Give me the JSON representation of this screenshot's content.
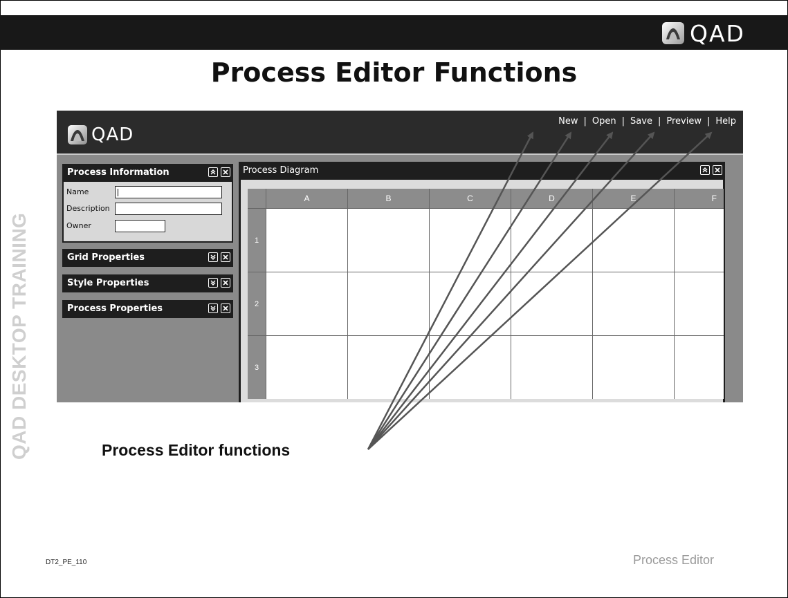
{
  "header": {
    "logo_text": "QAD",
    "slide_title": "Process Editor Functions",
    "side_text": "QAD DESKTOP TRAINING"
  },
  "app": {
    "logo_text": "QAD",
    "menu": [
      "New",
      "Open",
      "Save",
      "Preview",
      "Help"
    ],
    "menu_separator": "|",
    "panels": {
      "process_information": {
        "title": "Process Information",
        "fields": [
          {
            "label": "Name",
            "value": ""
          },
          {
            "label": "Description",
            "value": ""
          },
          {
            "label": "Owner",
            "value": ""
          }
        ]
      },
      "grid_properties": {
        "title": "Grid Properties"
      },
      "style_properties": {
        "title": "Style Properties"
      },
      "process_properties": {
        "title": "Process Properties"
      }
    },
    "diagram": {
      "title": "Process Diagram",
      "columns": [
        "A",
        "B",
        "C",
        "D",
        "E",
        "F"
      ],
      "rows": [
        "1",
        "2",
        "3"
      ]
    }
  },
  "caption": "Process Editor functions",
  "footer": {
    "slide_id": "DT2_PE_110",
    "section": "Process Editor"
  },
  "colors": {
    "title_bar": "#181818",
    "app_header": "#2b2b2b",
    "panel_header": "#1e1e1e",
    "arrow": "#555555",
    "side_text": "#cfcfcf"
  },
  "icons": {
    "collapse": "double-chevron-up-icon",
    "expand": "double-chevron-down-icon",
    "close": "close-icon"
  }
}
